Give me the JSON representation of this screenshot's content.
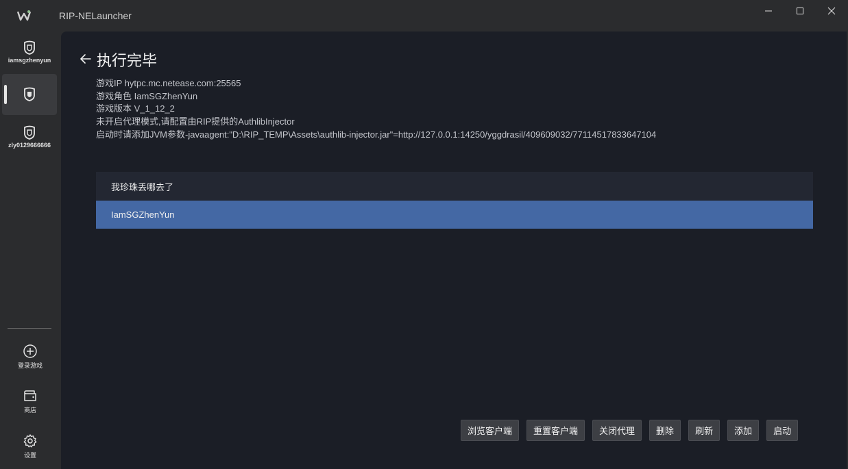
{
  "window": {
    "title": "RIP-NELauncher"
  },
  "sidebar": {
    "accounts": [
      {
        "label": "iamsgzhenyun",
        "active": false
      },
      {
        "label": "",
        "active": true
      },
      {
        "label": "zly0129666666",
        "active": false
      }
    ],
    "login_game": "登录游戏",
    "shop": "商店",
    "settings": "设置"
  },
  "main": {
    "title": "执行完毕",
    "info": {
      "game_ip": "游戏IP hytpc.mc.netease.com:25565",
      "game_role": "游戏角色 IamSGZhenYun",
      "game_version": "游戏版本 V_1_12_2",
      "proxy_note": "未开启代理模式,请配置由RIP提供的AuthlibInjector",
      "jvm_note": "启动时请添加JVM参数-javaagent:\"D:\\RIP_TEMP\\Assets\\authlib-injector.jar\"=http://127.0.0.1:14250/yggdrasil/409609032/77114517833647104"
    },
    "roles": [
      "我珍珠丢哪去了",
      "IamSGZhenYun"
    ],
    "selected_role_index": 1
  },
  "actions": {
    "browse_client": "浏览客户端",
    "reset_client": "重置客户端",
    "close_proxy": "关闭代理",
    "delete": "删除",
    "refresh": "刷新",
    "add": "添加",
    "launch": "启动"
  },
  "colors": {
    "background": "#2b2c2e",
    "main_panel": "#1b1e26",
    "row": "#232732",
    "selected_row": "#4468a4",
    "button": "#3d3f44"
  }
}
